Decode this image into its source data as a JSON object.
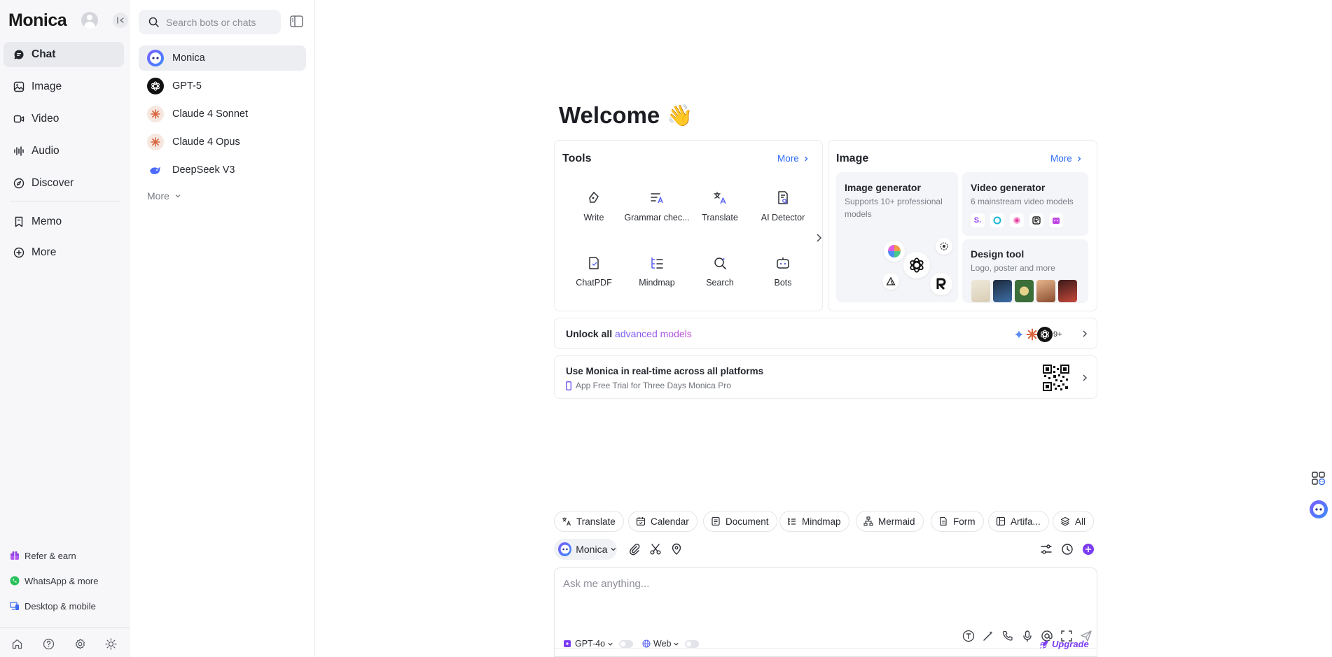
{
  "app": {
    "logo": "Monica"
  },
  "nav": {
    "items": [
      {
        "label": "Chat",
        "icon": "chat-bubble-icon",
        "active": true
      },
      {
        "label": "Image",
        "icon": "image-icon"
      },
      {
        "label": "Video",
        "icon": "video-icon"
      },
      {
        "label": "Audio",
        "icon": "audio-wave-icon"
      },
      {
        "label": "Discover",
        "icon": "compass-icon"
      },
      {
        "label": "Memo",
        "icon": "bookmark-icon"
      },
      {
        "label": "More",
        "icon": "plus-circle-icon"
      }
    ],
    "bottom": [
      {
        "label": "Refer & earn",
        "icon": "gift-icon"
      },
      {
        "label": "WhatsApp & more",
        "icon": "whatsapp-icon"
      },
      {
        "label": "Desktop & mobile",
        "icon": "devices-icon"
      }
    ],
    "footer_icons": [
      "home-icon",
      "help-icon",
      "settings-icon",
      "theme-sun-icon"
    ]
  },
  "botlist": {
    "search_placeholder": "Search bots or chats",
    "bots": [
      {
        "name": "Monica",
        "active": true
      },
      {
        "name": "GPT-5"
      },
      {
        "name": "Claude 4 Sonnet"
      },
      {
        "name": "Claude 4 Opus"
      },
      {
        "name": "DeepSeek V3"
      }
    ],
    "more_label": "More"
  },
  "main": {
    "welcome": "Welcome",
    "wave_emoji": "👋",
    "tools": {
      "title": "Tools",
      "more": "More",
      "items": [
        {
          "label": "Write",
          "icon": "write-icon"
        },
        {
          "label": "Grammar chec...",
          "icon": "grammar-icon"
        },
        {
          "label": "Translate",
          "icon": "translate-icon"
        },
        {
          "label": "AI Detector",
          "icon": "ai-detector-icon"
        },
        {
          "label": "ChatPDF",
          "icon": "chatpdf-icon"
        },
        {
          "label": "Mindmap",
          "icon": "mindmap-icon"
        },
        {
          "label": "Search",
          "icon": "search-sparkle-icon"
        },
        {
          "label": "Bots",
          "icon": "bot-icon"
        }
      ]
    },
    "image": {
      "title": "Image",
      "more": "More",
      "image_generator": {
        "title": "Image generator",
        "desc": "Supports 10+ professional models"
      },
      "video_generator": {
        "title": "Video generator",
        "desc": "6 mainstream video models"
      },
      "design_tool": {
        "title": "Design tool",
        "desc": "Logo, poster and more"
      }
    },
    "unlock": {
      "prefix": "Unlock all",
      "highlight": "advanced models",
      "badge": "9+"
    },
    "platforms": {
      "title": "Use Monica in real-time across all platforms",
      "subtitle": "App Free Trial for Three Days Monica Pro"
    },
    "chips": [
      {
        "label": "Translate",
        "icon": "translate-icon"
      },
      {
        "label": "Calendar",
        "icon": "calendar-icon"
      },
      {
        "label": "Document",
        "icon": "document-icon"
      },
      {
        "label": "Mindmap",
        "icon": "mindmap-icon"
      },
      {
        "label": "Mermaid",
        "icon": "mermaid-icon"
      },
      {
        "label": "Form",
        "icon": "form-icon"
      },
      {
        "label": "Artifa...",
        "icon": "artifact-icon"
      },
      {
        "label": "All",
        "icon": "layers-icon"
      }
    ],
    "model_selector": "Monica",
    "input_placeholder": "Ask me anything...",
    "footer": {
      "model": "GPT-4o",
      "web": "Web",
      "upgrade": "Upgrade"
    }
  },
  "colors": {
    "accent": "#2f6cf6",
    "brand_purple": "#7b3cf0",
    "nav_bg": "#f7f7f9"
  }
}
